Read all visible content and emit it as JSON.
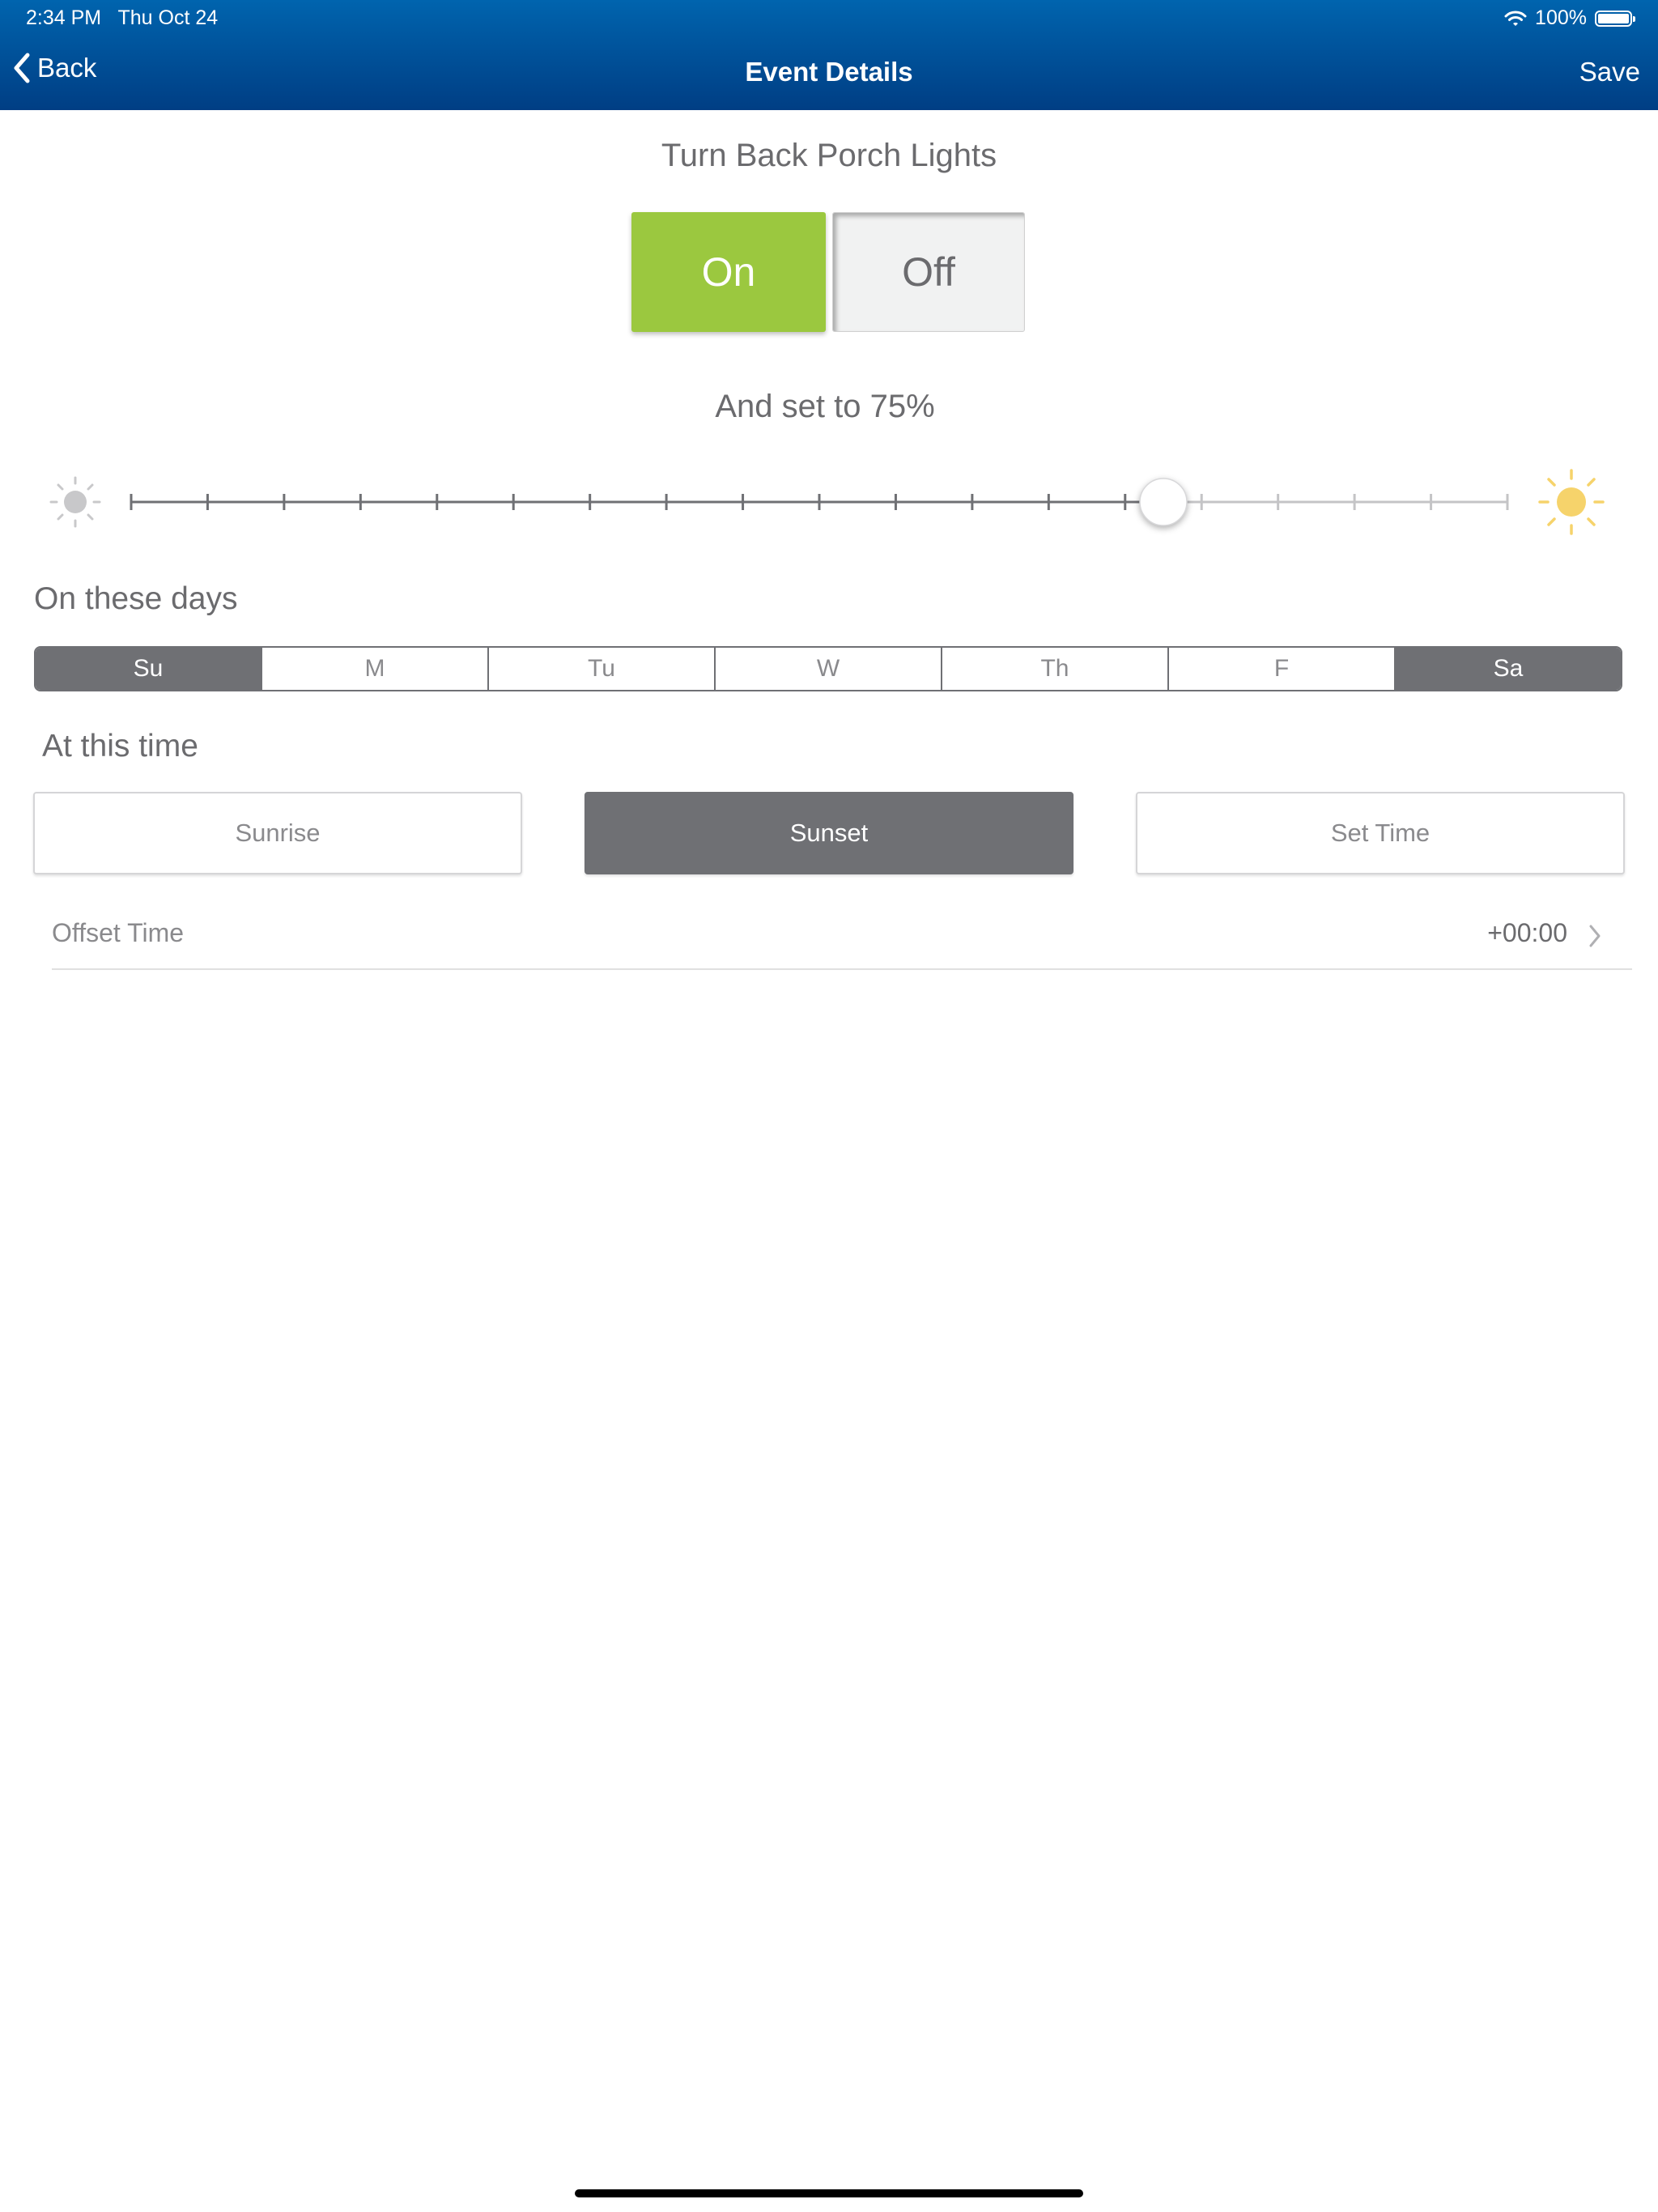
{
  "status_bar": {
    "time": "2:34 PM",
    "date": "Thu Oct 24",
    "battery_text": "100%"
  },
  "nav": {
    "back_label": "Back",
    "title": "Event Details",
    "save_label": "Save"
  },
  "device_heading": "Turn Back Porch Lights",
  "power_toggle": {
    "on_label": "On",
    "off_label": "Off",
    "selected": "On",
    "on_color": "#9bc83f"
  },
  "brightness": {
    "label": "And set to 75%",
    "value_percent": 75
  },
  "days_section": {
    "label": "On these days",
    "days": [
      {
        "label": "Su",
        "selected": true
      },
      {
        "label": "M",
        "selected": false
      },
      {
        "label": "Tu",
        "selected": false
      },
      {
        "label": "W",
        "selected": false
      },
      {
        "label": "Th",
        "selected": false
      },
      {
        "label": "F",
        "selected": false
      },
      {
        "label": "Sa",
        "selected": true
      }
    ]
  },
  "time_section": {
    "label": "At this time",
    "options": [
      {
        "label": "Sunrise",
        "selected": false
      },
      {
        "label": "Sunset",
        "selected": true
      },
      {
        "label": "Set Time",
        "selected": false
      }
    ]
  },
  "offset": {
    "label": "Offset Time",
    "value": "+00:00"
  },
  "colors": {
    "header_top": "#0064ae",
    "header_bottom": "#003e84",
    "selected_gray": "#6f7074",
    "sun_yellow": "#f6d36b"
  }
}
